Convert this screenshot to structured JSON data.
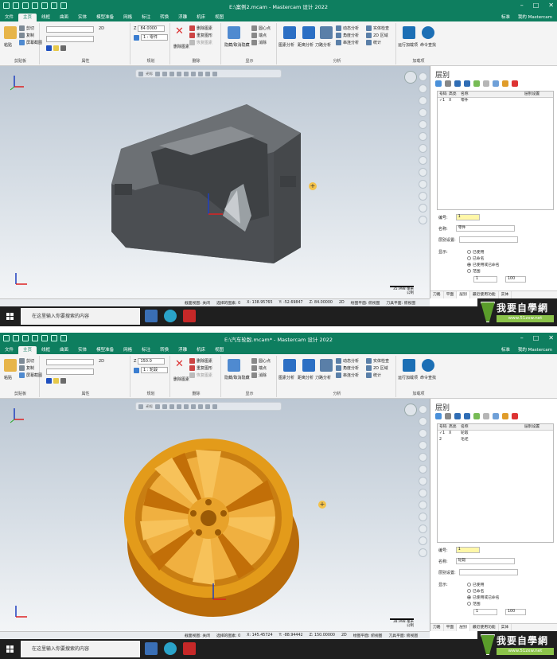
{
  "colors": {
    "title_bar": "#0e7e5f",
    "model1": "#5c5f62",
    "model2": "#e39b1a",
    "status_bg": "#e9ecef"
  },
  "panels": [
    {
      "title": "E:\\案例2.mcam - Mastercam 设计 2022",
      "menus": [
        "文件",
        "主页",
        "线框",
        "曲面",
        "实体",
        "模型准备",
        "网格",
        "标注",
        "转换",
        "浮雕",
        "机床",
        "视图"
      ],
      "menu_right": [
        "标准",
        "我的 Mastercam"
      ],
      "ribbon": {
        "clipboard": {
          "paste": "粘贴",
          "cut": "剪切",
          "copy": "复制",
          "screenshot": "屏幕截图",
          "label": "剪贴板"
        },
        "attributes": {
          "dim": "2D",
          "label": "属性"
        },
        "planning": {
          "z_value": "84.0000",
          "level_value": "1 : 零件",
          "label": "规划"
        },
        "delete": {
          "delete": "删除图素",
          "restore": "重复图形",
          "recover": "恢复图素",
          "delete_entities": "删除图素",
          "label": "删除"
        },
        "display": {
          "hide": "隐藏/取消隐藏",
          "round": "圆心点",
          "endpoint": "端点",
          "clear": "消除",
          "label": "显示"
        },
        "analysis": {
          "entity": "图素分析",
          "distance": "距离分析",
          "toolpath": "刀路分析",
          "dynamic": "动态分析",
          "angle": "角度分析",
          "chain": "串连分析",
          "solid": "实体检查",
          "area2d": "2D 区域",
          "stats": "统计",
          "label": "分析"
        },
        "addins": {
          "run": "运行加载项",
          "search": "命令查找",
          "label": "加载项"
        }
      },
      "viewport": {
        "toolbar_label": "光标"
      },
      "scale": {
        "value": "35.998 毫米",
        "unit": "公制"
      },
      "levels": {
        "title": "层别",
        "headers": [
          "号码",
          "高亮",
          "名称",
          "层别设置"
        ],
        "rows": [
          {
            "num": "1",
            "mark": "✓",
            "hi": "X",
            "name": "零件"
          }
        ],
        "number_label": "编号:",
        "number_value": "1",
        "name_label": "名称:",
        "name_value": "零件",
        "set_label": "层别设置:",
        "display_label": "显示:",
        "options": [
          "已使用",
          "已命名",
          "已使用或已命名",
          "范围"
        ],
        "range_from": "1",
        "range_to": "100",
        "tabs": [
          "刀路",
          "平面",
          "层别",
          "最近使用功能",
          "实体"
        ]
      },
      "status": {
        "section": "截面视图: 关闭",
        "selected": "选择的图素: 0",
        "x_label": "X:",
        "x": "138.95765",
        "y_label": "Y:",
        "y": "-52.69847",
        "z_label": "Z:",
        "z": "84.00000",
        "mode": "2D",
        "plane": "绘图平面: 俯视图",
        "tool": "刀具平面: 俯视图"
      },
      "taskbar": {
        "search": "在这里输入你要搜索的内容"
      }
    },
    {
      "title": "E:\\汽车轮毂.mcam* - Mastercam 设计 2022",
      "menus": [
        "文件",
        "主页",
        "线框",
        "曲面",
        "实体",
        "模型准备",
        "网格",
        "标注",
        "转换",
        "浮雕",
        "机床",
        "视图"
      ],
      "menu_right": [
        "标准",
        "我的 Mastercam"
      ],
      "ribbon": {
        "clipboard": {
          "paste": "粘贴",
          "cut": "剪切",
          "copy": "复制",
          "screenshot": "屏幕截图",
          "label": "剪贴板"
        },
        "attributes": {
          "dim": "2D",
          "label": "属性"
        },
        "planning": {
          "z_value": "150.0",
          "level_value": "1 : 轮毂",
          "label": "规划"
        },
        "delete": {
          "delete": "删除图素",
          "restore": "重复图形",
          "recover": "恢复图素",
          "delete_entities": "删除图素",
          "label": "删除"
        },
        "display": {
          "hide": "隐藏/取消隐藏",
          "round": "圆心点",
          "endpoint": "端点",
          "clear": "消除",
          "label": "显示"
        },
        "analysis": {
          "entity": "图素分析",
          "distance": "距离分析",
          "toolpath": "刀路分析",
          "dynamic": "动态分析",
          "angle": "角度分析",
          "chain": "串连分析",
          "solid": "实体检查",
          "area2d": "2D 区域",
          "stats": "统计",
          "label": "分析"
        },
        "addins": {
          "run": "运行加载项",
          "search": "命令查找",
          "label": "加载项"
        }
      },
      "viewport": {
        "toolbar_label": "光标"
      },
      "scale": {
        "value": "38.998 毫米",
        "unit": "公制"
      },
      "levels": {
        "title": "层别",
        "headers": [
          "号码",
          "高亮",
          "名称",
          "层别设置"
        ],
        "rows": [
          {
            "num": "1",
            "mark": "✓",
            "hi": "X",
            "name": "轮毂"
          },
          {
            "num": "2",
            "mark": "",
            "hi": "",
            "name": "毛坯"
          }
        ],
        "number_label": "编号:",
        "number_value": "1",
        "name_label": "名称:",
        "name_value": "轮毂",
        "set_label": "层别设置:",
        "display_label": "显示:",
        "options": [
          "已使用",
          "已命名",
          "已使用或已命名",
          "范围"
        ],
        "range_from": "1",
        "range_to": "100",
        "tabs": [
          "刀路",
          "平面",
          "层别",
          "最近使用功能",
          "实体"
        ]
      },
      "status": {
        "section": "截面视图: 关闭",
        "selected": "选择的图素: 0",
        "x_label": "X:",
        "x": "145.45724",
        "y_label": "Y:",
        "y": "-88.94442",
        "z_label": "Z:",
        "z": "150.00000",
        "mode": "2D",
        "plane": "绘图平面: 俯视图",
        "tool": "刀具平面: 俯视图"
      },
      "taskbar": {
        "search": "在这里输入你要搜索的内容"
      }
    }
  ],
  "brand": {
    "title": "我要自學網",
    "url": "www.51zxw.net"
  }
}
